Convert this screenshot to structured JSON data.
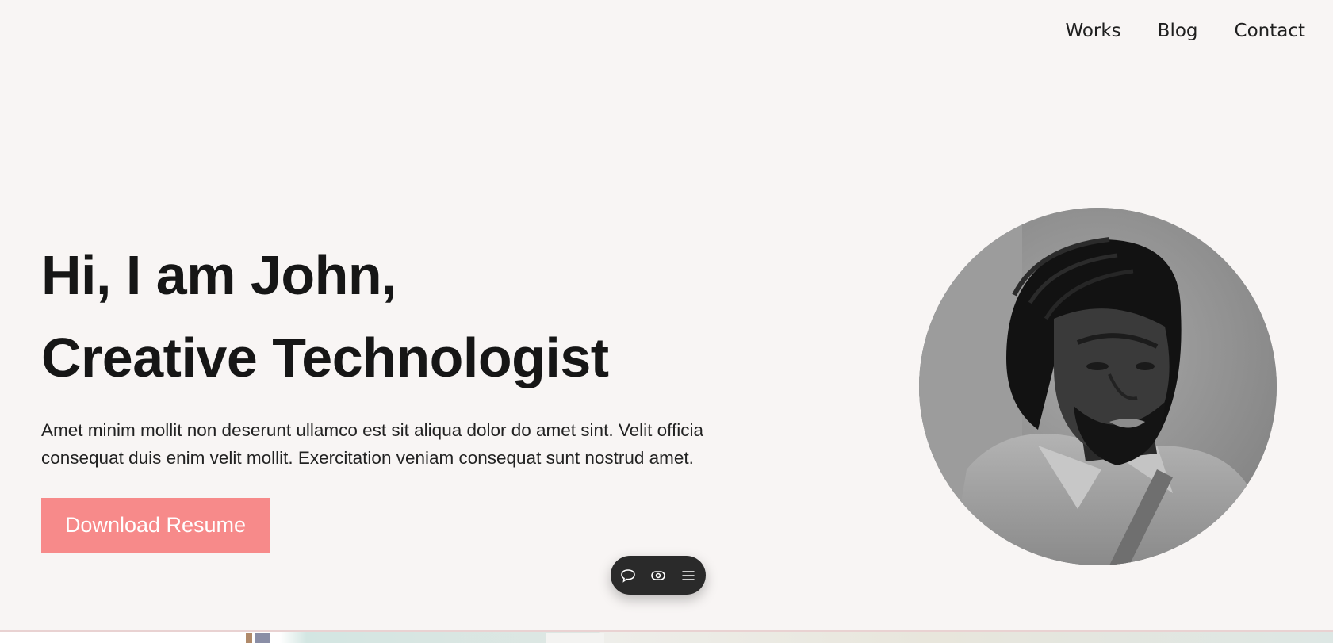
{
  "nav": {
    "items": [
      {
        "label": "Works"
      },
      {
        "label": "Blog"
      },
      {
        "label": "Contact"
      }
    ]
  },
  "hero": {
    "title_line1": "Hi, I am John,",
    "title_line2": "Creative Technologist",
    "description": "Amet minim mollit non deserunt ullamco est sit aliqua dolor do amet sint. Velit officia consequat duis enim velit mollit. Exercitation veniam consequat sunt nostrud amet.",
    "button_label": "Download Resume"
  },
  "toolbar": {
    "icons": [
      "comment-icon",
      "eye-icon",
      "menu-icon"
    ]
  },
  "colors": {
    "background": "#f8f5f4",
    "button": "#f78a8a",
    "text": "#161616",
    "toolbar": "#2a2a2a"
  }
}
